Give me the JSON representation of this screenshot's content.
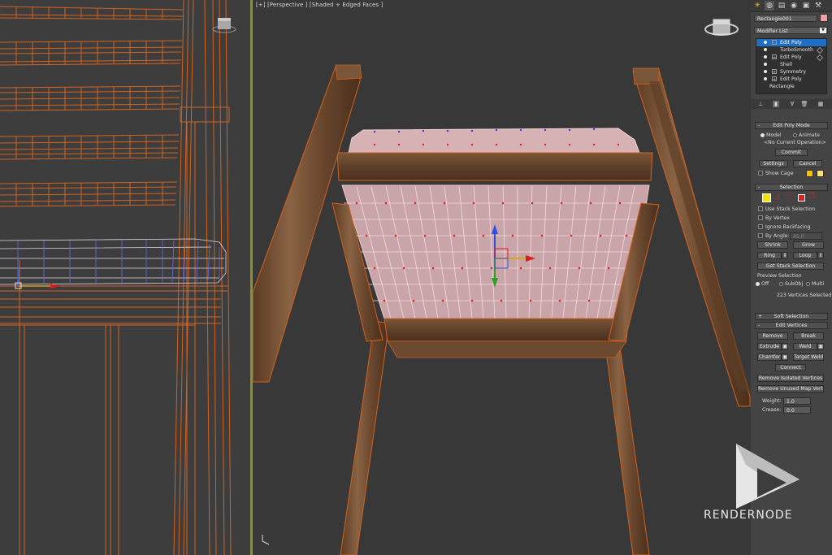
{
  "viewport": {
    "label": "[+] [Perspective ] [Shaded + Edged Faces ]"
  },
  "panel": {
    "tabs": [
      "sun-icon",
      "curve-icon",
      "hierarchy-icon",
      "motion-icon",
      "display-icon",
      "utilities-icon"
    ],
    "object_name": "Rectangle001",
    "object_color": "#f0a0a0",
    "modifier_list": "Modifier List",
    "stack": [
      {
        "label": "Edit Poly",
        "selected": true,
        "pin": false
      },
      {
        "label": "TurboSmooth",
        "selected": false,
        "pin": true
      },
      {
        "label": "Edit Poly",
        "selected": false,
        "pin": true
      },
      {
        "label": "Shell",
        "selected": false,
        "pin": false
      },
      {
        "label": "Symmetry",
        "selected": false,
        "pin": false
      },
      {
        "label": "Edit Poly",
        "selected": false,
        "pin": false
      },
      {
        "label": "Rectangle",
        "selected": false,
        "pin": false
      }
    ],
    "edit_poly_mode": {
      "title": "Edit Poly Mode",
      "model": "Model",
      "animate": "Animate",
      "current_op": "<No Current Operation>",
      "commit": "Commit",
      "settings": "Settings",
      "cancel": "Cancel",
      "show_cage": "Show Cage",
      "cage_color_1": "#ffc000",
      "cage_color_2": "#f8e07a"
    },
    "selection": {
      "title": "Selection",
      "use_stack": "Use Stack Selection",
      "by_vertex": "By Vertex",
      "ignore_backfacing": "Ignore Backfacing",
      "by_angle": "By Angle:",
      "angle_value": "45.0",
      "shrink": "Shrink",
      "grow": "Grow",
      "ring": "Ring",
      "loop": "Loop",
      "get_stack": "Get Stack Selection",
      "preview_title": "Preview Selection",
      "preview_off": "Off",
      "preview_subobj": "SubObj",
      "preview_multi": "Multi",
      "status": "223 Vertices Selected"
    },
    "soft_selection": {
      "title": "Soft Selection"
    },
    "edit_vertices": {
      "title": "Edit Vertices",
      "remove": "Remove",
      "break": "Break",
      "extrude": "Extrude",
      "weld": "Weld",
      "chamfer": "Chamfer",
      "target_weld": "Target Weld",
      "connect": "Connect",
      "remove_isolated": "Remove Isolated Vertices",
      "remove_unused": "Remove Unused Map Verts",
      "weight_label": "Weight:",
      "weight_value": "1.0",
      "crease_label": "Crease:",
      "crease_value": "0.0"
    }
  },
  "watermark": {
    "text": "RENDERNODE"
  }
}
